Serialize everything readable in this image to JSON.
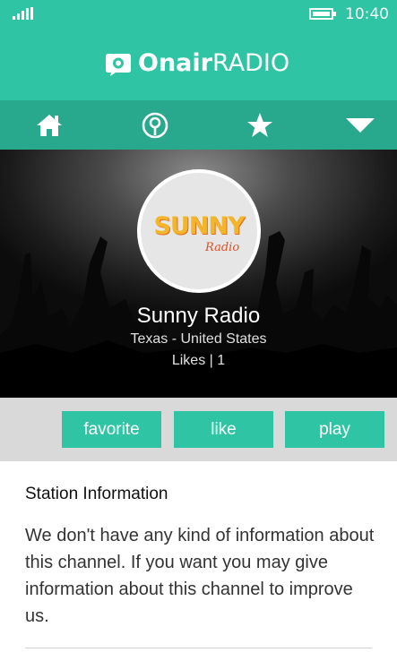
{
  "status_bar": {
    "time": "10:40",
    "signal_icon": "signal-bars-icon",
    "battery_icon": "battery-icon"
  },
  "header": {
    "logo_icon": "onair-logo-icon",
    "title_bold": "Onair",
    "title_light": "RADIO"
  },
  "nav": {
    "items": [
      {
        "icon": "home-icon"
      },
      {
        "icon": "radio-pin-icon"
      },
      {
        "icon": "star-icon"
      },
      {
        "icon": "chevron-down-icon"
      }
    ]
  },
  "station": {
    "logo_text_main": "SUNNY",
    "logo_text_sub": "Radio",
    "name": "Sunny Radio",
    "location": "Texas - United States",
    "likes": "Likes | 1"
  },
  "actions": {
    "favorite": "favorite",
    "like": "like",
    "play": "play"
  },
  "info": {
    "title": "Station Information",
    "text": "We don't have any kind of information about this channel. If you want you may give information about this channel to improve us."
  },
  "colors": {
    "accent": "#2ec4a4",
    "nav_bg": "#28a88c",
    "action_bar_bg": "#d9d9d9"
  }
}
